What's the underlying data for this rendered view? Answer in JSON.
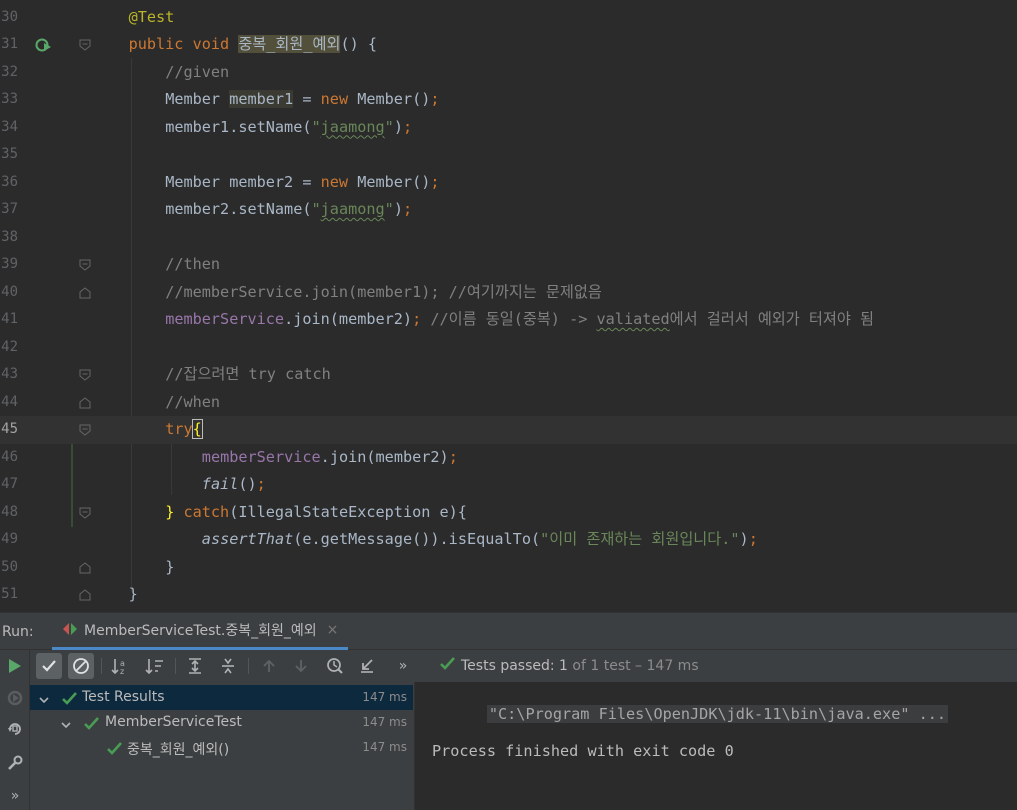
{
  "editor": {
    "lines": [
      {
        "num": "30",
        "tokens": [
          [
            "ann",
            "@Test"
          ]
        ]
      },
      {
        "num": "31",
        "tokens": [
          [
            "kw",
            "public "
          ],
          [
            "kw",
            "void "
          ],
          [
            "hl-name",
            "중복_회원_예외"
          ],
          [
            "",
            "() {"
          ]
        ]
      },
      {
        "num": "32",
        "tokens": [
          [
            "cmt",
            "//given"
          ]
        ]
      },
      {
        "num": "33",
        "tokens": [
          [
            "",
            "Member "
          ],
          [
            "hl-var",
            "member1"
          ],
          [
            "",
            " = "
          ],
          [
            "kw",
            "new "
          ],
          [
            "",
            "Member()"
          ],
          [
            "kw",
            ";"
          ]
        ]
      },
      {
        "num": "34",
        "tokens": [
          [
            "",
            "member1.setName("
          ],
          [
            "str",
            "\""
          ],
          [
            "str wavy",
            "jaamong"
          ],
          [
            "str",
            "\""
          ],
          [
            "",
            ")"
          ],
          [
            "kw",
            ";"
          ]
        ]
      },
      {
        "num": "35",
        "tokens": []
      },
      {
        "num": "36",
        "tokens": [
          [
            "",
            "Member member2 = "
          ],
          [
            "kw",
            "new "
          ],
          [
            "",
            "Member()"
          ],
          [
            "kw",
            ";"
          ]
        ]
      },
      {
        "num": "37",
        "tokens": [
          [
            "",
            "member2.setName("
          ],
          [
            "str",
            "\""
          ],
          [
            "str wavy",
            "jaamong"
          ],
          [
            "str",
            "\""
          ],
          [
            "",
            ")"
          ],
          [
            "kw",
            ";"
          ]
        ]
      },
      {
        "num": "38",
        "tokens": []
      },
      {
        "num": "39",
        "tokens": [
          [
            "cmt",
            "//then"
          ]
        ]
      },
      {
        "num": "40",
        "tokens": [
          [
            "cmt",
            "//memberService.join(member1); //여기까지는 문제없음"
          ]
        ]
      },
      {
        "num": "41",
        "tokens": [
          [
            "fld",
            "memberService"
          ],
          [
            "",
            ".join(member2)"
          ],
          [
            "kw",
            "; "
          ],
          [
            "cmt",
            "//이름 동일(중복) -> "
          ],
          [
            "cmt wavy",
            "valiated"
          ],
          [
            "cmt",
            "에서 걸러서 예외가 터져야 됨"
          ]
        ]
      },
      {
        "num": "42",
        "tokens": []
      },
      {
        "num": "43",
        "tokens": [
          [
            "cmt",
            "//잡으려면 try catch"
          ]
        ]
      },
      {
        "num": "44",
        "tokens": [
          [
            "cmt",
            "//when"
          ]
        ]
      },
      {
        "num": "45",
        "tokens": [
          [
            "kw",
            "try"
          ],
          [
            "caret-brace",
            "{"
          ]
        ]
      },
      {
        "num": "46",
        "tokens": [
          [
            "fld",
            "memberService"
          ],
          [
            "",
            ".join(member2)"
          ],
          [
            "kw",
            ";"
          ]
        ]
      },
      {
        "num": "47",
        "tokens": [
          [
            "ital",
            "fail"
          ],
          [
            "",
            "()"
          ],
          [
            "kw",
            ";"
          ]
        ]
      },
      {
        "num": "48",
        "tokens": [
          [
            "brace",
            "}"
          ],
          [
            "kw",
            " catch"
          ],
          [
            "",
            "(IllegalStateException e){"
          ]
        ]
      },
      {
        "num": "49",
        "tokens": [
          [
            "ital",
            "assertThat"
          ],
          [
            "",
            "(e.getMessage()).isEqualTo("
          ],
          [
            "str",
            "\"이미 존재하는 회원입니다.\""
          ],
          [
            "",
            ")"
          ],
          [
            "kw",
            ";"
          ]
        ]
      },
      {
        "num": "50",
        "tokens": [
          [
            "",
            "}"
          ]
        ]
      },
      {
        "num": "51",
        "tokens": [
          [
            "",
            "}"
          ]
        ]
      }
    ]
  },
  "run_panel": {
    "label": "Run:",
    "tab_title": "MemberServiceTest.중복_회원_예외",
    "close_glyph": "×",
    "more_glyph": "»",
    "status_passed": "Tests passed:",
    "status_count": "1",
    "status_rest": "of 1 test – 147 ms",
    "tree": [
      {
        "label": "Test Results",
        "time": "147 ms"
      },
      {
        "label": "MemberServiceTest",
        "time": "147 ms"
      },
      {
        "label": "중복_회원_예외()",
        "time": "147 ms"
      }
    ],
    "console": {
      "command": "\"C:\\Program Files\\OpenJDK\\jdk-11\\bin\\java.exe\" ...",
      "exit": "Process finished with exit code 0"
    },
    "side_more": "»"
  },
  "colors": {
    "pass_green": "#499c54",
    "run_green": "#59a869",
    "keyword": "#cc7832",
    "string": "#6a8759"
  }
}
